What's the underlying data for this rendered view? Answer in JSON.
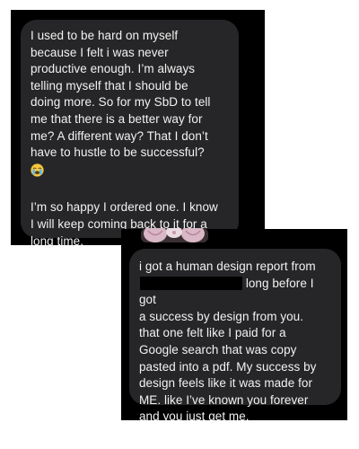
{
  "screenshot_1": {
    "bubble": {
      "lines": [
        "I used to be hard on myself",
        "because I felt i was never",
        "productive enough. I’m always",
        "telling myself that I should be",
        "doing more. So for my SbD to tell",
        "me that there is a better way for",
        "me? A different way? That I don’t",
        "have to hustle to be successful?"
      ],
      "emoji": "crying-face-emoji",
      "lines_2": [
        "I’m so happy I ordered one. I know",
        "I will keep coming back to it for a",
        "long time."
      ]
    }
  },
  "screenshot_2": {
    "bubble": {
      "line_1": "i got a human design report from",
      "line_2_after_redaction": "long before I got",
      "lines": [
        "a success by design from you.",
        "that one felt like I paid for a",
        "Google search that was copy",
        "pasted into a pdf. My success by",
        "design feels like it was made for",
        "ME. like I’ve known you forever",
        "and you just get me."
      ]
    }
  },
  "colors": {
    "background": "#ffffff",
    "screenshot_bg": "#000000",
    "bubble_bg": "#262628",
    "text": "#f2f2f2"
  }
}
